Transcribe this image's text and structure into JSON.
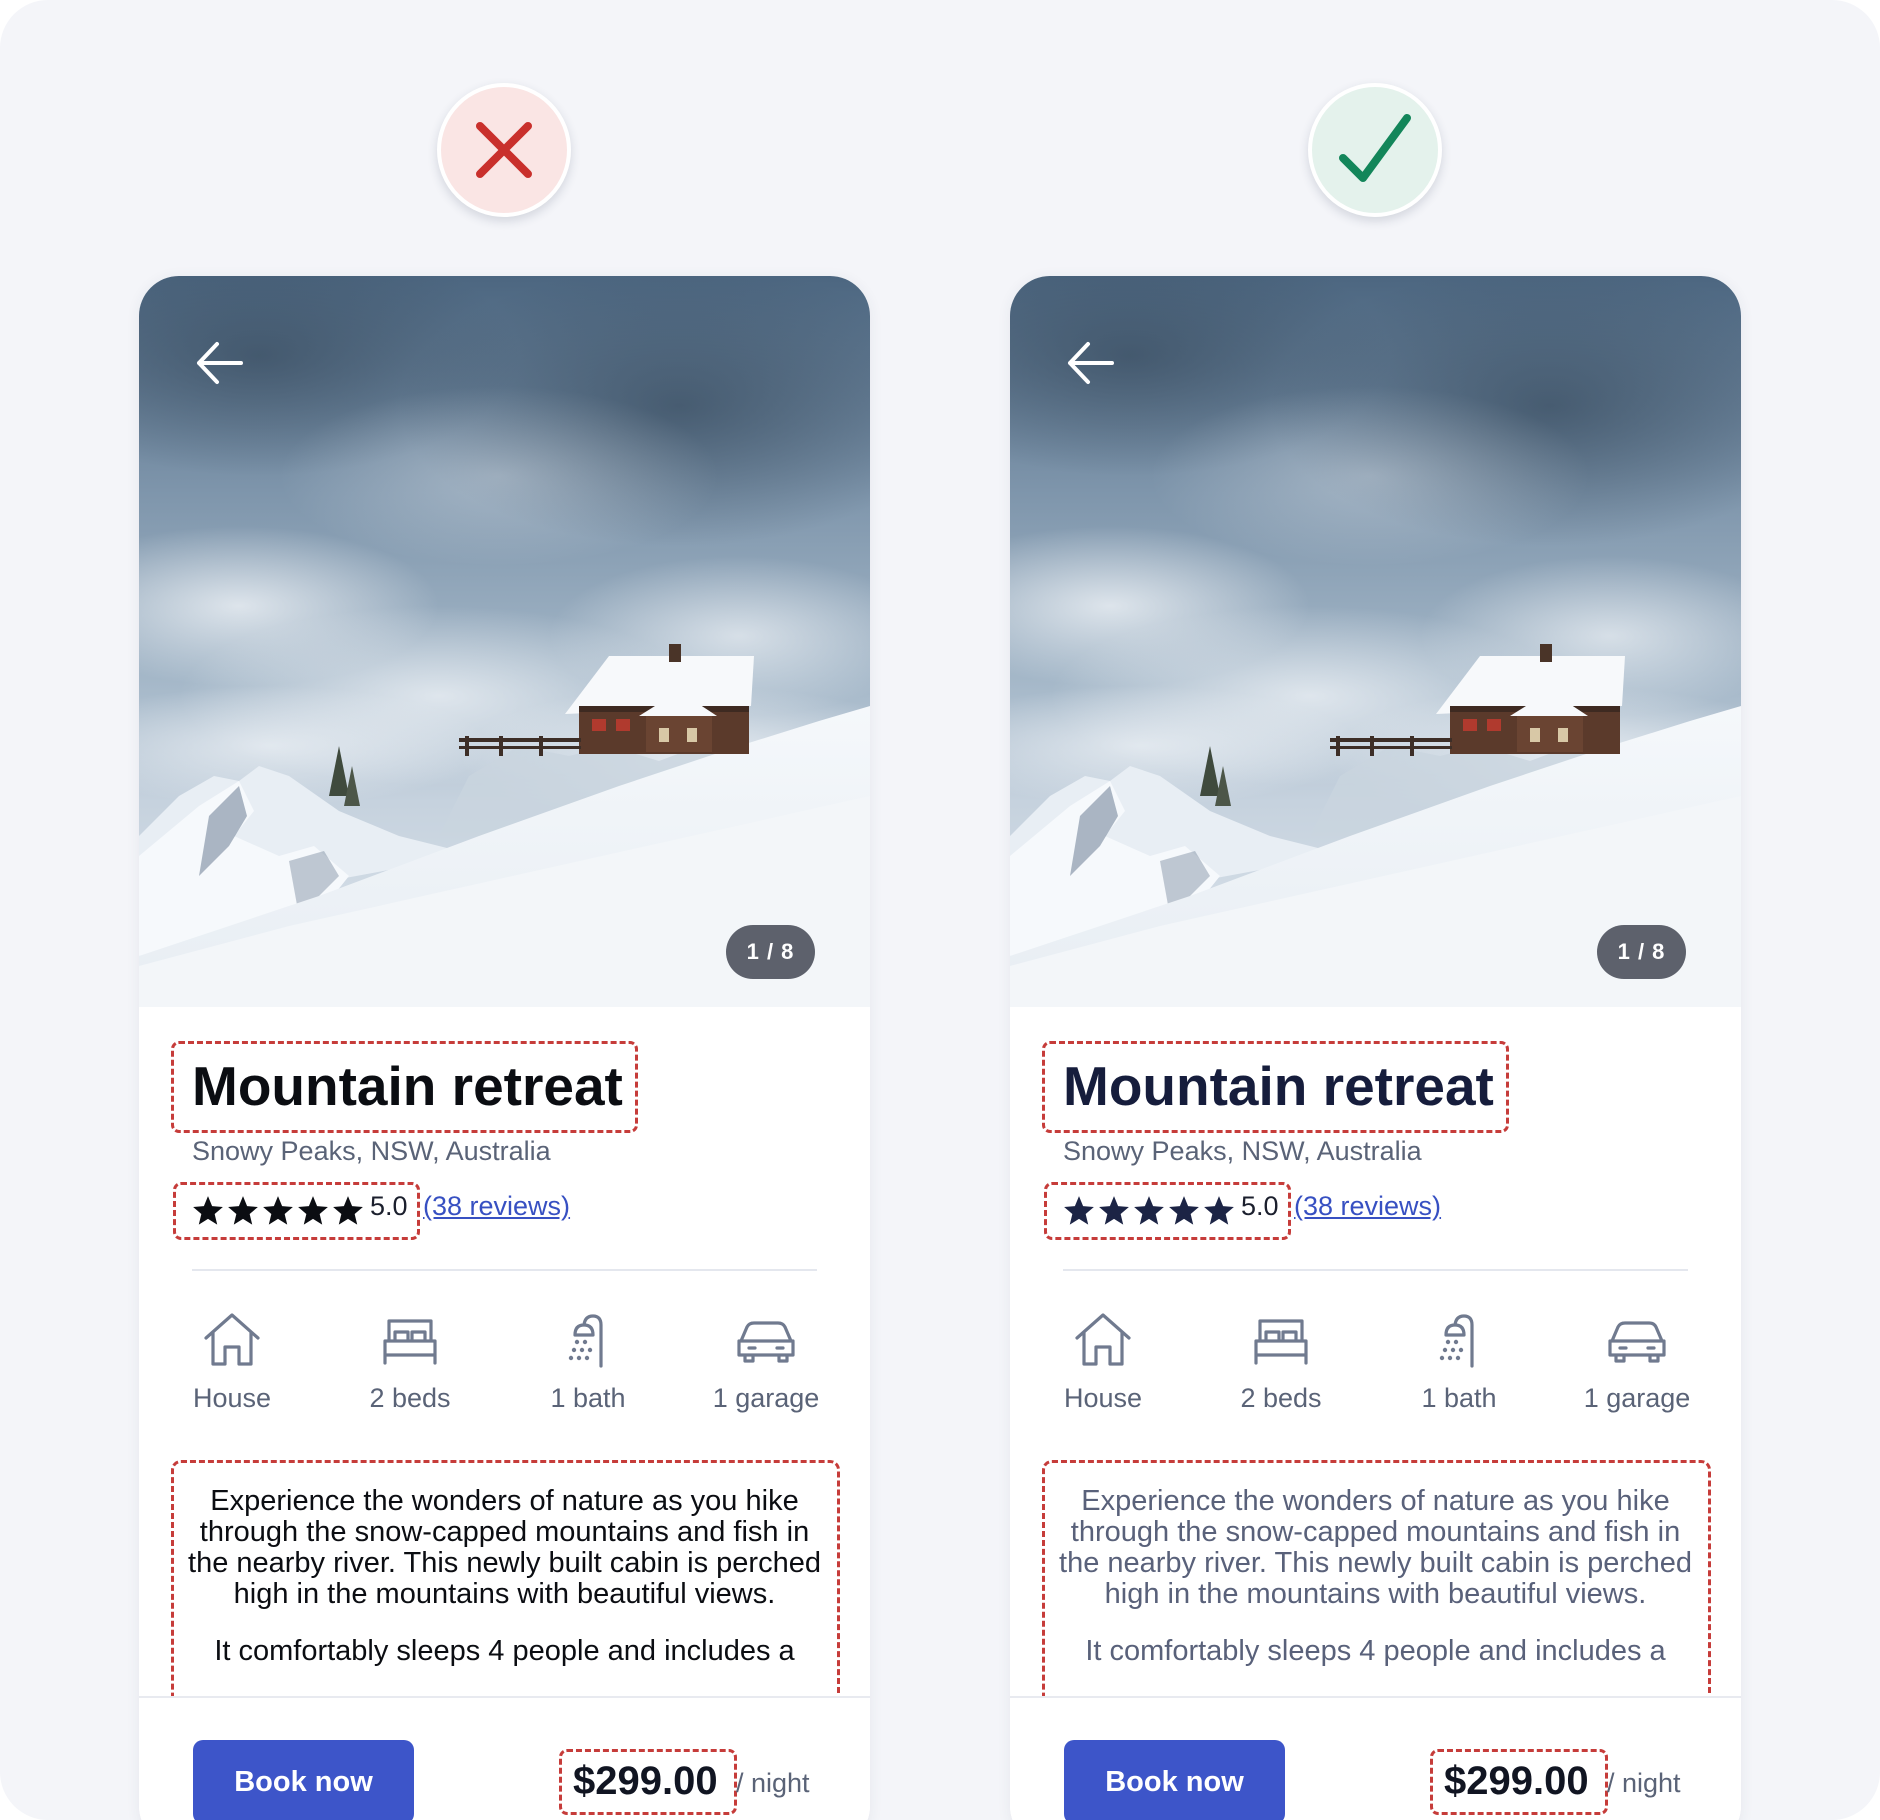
{
  "badges": {
    "incorrect_icon": "close-icon",
    "correct_icon": "check-icon",
    "incorrect_color": "#c9302c",
    "correct_color": "#13865a"
  },
  "listings": [
    {
      "variant": "incorrect",
      "photo_counter": "1 / 8",
      "title": "Mountain retreat",
      "location": "Snowy Peaks, NSW, Australia",
      "rating": "5.0",
      "star_count": 5,
      "reviews_link": "(38 reviews)",
      "amenities": [
        {
          "icon": "house-icon",
          "label": "House"
        },
        {
          "icon": "bed-icon",
          "label": "2 beds"
        },
        {
          "icon": "shower-icon",
          "label": "1 bath"
        },
        {
          "icon": "car-icon",
          "label": "1 garage"
        }
      ],
      "description": {
        "p1": "Experience the wonders of nature as you hike through the snow-capped mountains and fish in the nearby river. This newly built cabin is perched high in the mountains with beautiful views.",
        "p2": "It comfortably sleeps 4 people and includes a"
      },
      "book_button": "Book now",
      "price": "$299.00",
      "price_unit": "/ night",
      "colors": {
        "title": "#0b0d12",
        "stars": "#0b0d12",
        "description": "#0b0d12",
        "price": "#111522"
      }
    },
    {
      "variant": "correct",
      "photo_counter": "1 / 8",
      "title": "Mountain retreat",
      "location": "Snowy Peaks, NSW, Australia",
      "rating": "5.0",
      "star_count": 5,
      "reviews_link": "(38 reviews)",
      "amenities": [
        {
          "icon": "house-icon",
          "label": "House"
        },
        {
          "icon": "bed-icon",
          "label": "2 beds"
        },
        {
          "icon": "shower-icon",
          "label": "1 bath"
        },
        {
          "icon": "car-icon",
          "label": "1 garage"
        }
      ],
      "description": {
        "p1": "Experience the wonders of nature as you hike through the snow-capped mountains and fish in the nearby river. This newly built cabin is perched high in the mountains with beautiful views.",
        "p2": "It comfortably sleeps 4 people and includes a"
      },
      "book_button": "Book now",
      "price": "$299.00",
      "price_unit": "/ night",
      "colors": {
        "title": "#161d3c",
        "stars": "#1c2445",
        "description": "#59617a",
        "price": "#111522"
      }
    }
  ],
  "theme": {
    "page_background": "#f4f5f9",
    "annotation_dash": "#c63c3a",
    "button": "#3d55c9",
    "link": "#3750c2",
    "secondary_text": "#5a6377"
  }
}
